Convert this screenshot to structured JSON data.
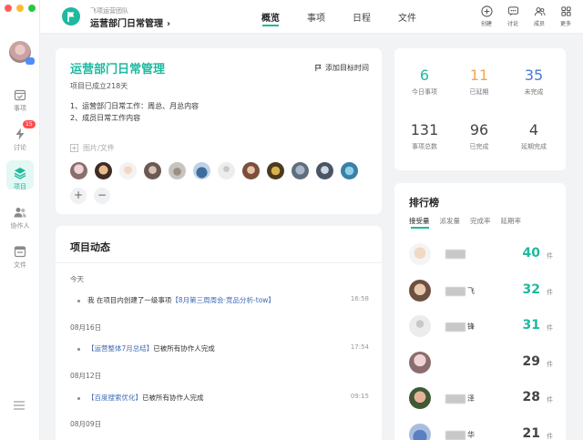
{
  "header": {
    "team": "飞项运营团队",
    "project": "运营部门日常管理",
    "tabs": [
      {
        "label": "概览",
        "active": true
      },
      {
        "label": "事项",
        "active": false
      },
      {
        "label": "日程",
        "active": false
      },
      {
        "label": "文件",
        "active": false
      }
    ],
    "tools": [
      "创建",
      "讨论",
      "成员",
      "更多"
    ]
  },
  "sidebar": {
    "items": [
      {
        "label": "事项",
        "icon": "calendar-check-icon"
      },
      {
        "label": "讨论",
        "icon": "bolt-chat-icon",
        "badge": "15"
      },
      {
        "label": "项目",
        "icon": "layers-icon",
        "active": true
      },
      {
        "label": "协作人",
        "icon": "people-icon"
      },
      {
        "label": "文件",
        "icon": "folder-icon"
      }
    ]
  },
  "overview": {
    "title": "运营部门日常管理",
    "add_goal_time": "添加目标时间",
    "age": "项目已成立218天",
    "desc_lines": [
      "1、运营部门日常工作：周总、月总内容",
      "2、成员日常工作内容"
    ],
    "attach_label": "图片/文件"
  },
  "activity": {
    "title": "项目动态",
    "groups": [
      {
        "date": "今天",
        "text": "我 在项目内创建了一级事项",
        "link": "【8月第三周周会·竞品分析-tow】",
        "suffix": "",
        "time": "16:58"
      },
      {
        "date": "08月16日",
        "text": "",
        "link": "【运营整体7月总结】",
        "suffix": "已被所有协作人完成",
        "time": "17:54"
      },
      {
        "date": "08月12日",
        "text": "",
        "link": "【百度搜索优化】",
        "suffix": "已被所有协作人完成",
        "time": "09:15"
      },
      {
        "date": "08月09日",
        "text": "",
        "link": "",
        "suffix": "",
        "time": ""
      }
    ]
  },
  "stats": [
    {
      "value": "6",
      "label": "今日事项",
      "color": "#1fb99f"
    },
    {
      "value": "11",
      "label": "已延期",
      "color": "#f5a54a"
    },
    {
      "value": "35",
      "label": "未完成",
      "color": "#4a78d6"
    },
    {
      "value": "131",
      "label": "事项总数",
      "color": "#444444"
    },
    {
      "value": "96",
      "label": "已完成",
      "color": "#444444"
    },
    {
      "value": "4",
      "label": "延期完成",
      "color": "#444444"
    }
  ],
  "ranking": {
    "title": "排行榜",
    "tabs": [
      "接受量",
      "派发量",
      "完成率",
      "延期率"
    ],
    "rows": [
      {
        "name_a": "",
        "name_b": "",
        "score": "40",
        "unit": "件",
        "color": "#1fb99f"
      },
      {
        "name_a": "",
        "name_b": "飞",
        "score": "32",
        "unit": "件",
        "color": "#1fb99f"
      },
      {
        "name_a": "",
        "name_b": "锋",
        "score": "31",
        "unit": "件",
        "color": "#1fb99f"
      },
      {
        "name_a": "",
        "name_b": "",
        "score": "29",
        "unit": "件",
        "color": "#444444"
      },
      {
        "name_a": "",
        "name_b": "泽",
        "score": "28",
        "unit": "件",
        "color": "#444444"
      },
      {
        "name_a": "",
        "name_b": "华",
        "score": "21",
        "unit": "件",
        "color": "#444444"
      }
    ]
  }
}
